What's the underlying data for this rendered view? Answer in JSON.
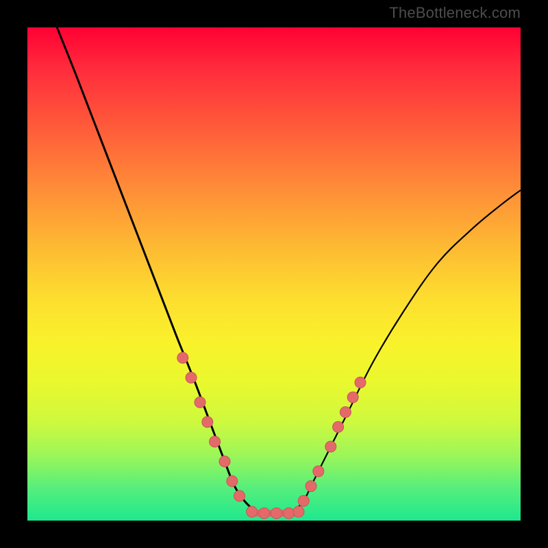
{
  "watermark": "TheBottleneck.com",
  "chart_data": {
    "type": "line",
    "title": "",
    "xlabel": "",
    "ylabel": "",
    "xlim": [
      0,
      100
    ],
    "ylim": [
      0,
      100
    ],
    "grid": false,
    "legend": false,
    "series": [
      {
        "name": "left-curve",
        "x": [
          6,
          10,
          15,
          20,
          25,
          30,
          34,
          37,
          40,
          42,
          44,
          46
        ],
        "values": [
          100,
          90,
          77,
          64,
          51,
          38,
          28,
          20,
          12,
          7,
          4,
          2
        ]
      },
      {
        "name": "right-curve",
        "x": [
          54,
          56,
          58,
          61,
          65,
          70,
          76,
          83,
          90,
          96,
          100
        ],
        "values": [
          2,
          4,
          8,
          14,
          22,
          32,
          42,
          52,
          59,
          64,
          67
        ]
      },
      {
        "name": "plateau",
        "x": [
          46,
          54
        ],
        "values": [
          1.5,
          1.5
        ]
      }
    ],
    "markers": [
      {
        "series": "left-curve",
        "x": 31.5,
        "y": 33
      },
      {
        "series": "left-curve",
        "x": 33.2,
        "y": 29
      },
      {
        "series": "left-curve",
        "x": 35.0,
        "y": 24
      },
      {
        "series": "left-curve",
        "x": 36.5,
        "y": 20
      },
      {
        "series": "left-curve",
        "x": 38.0,
        "y": 16
      },
      {
        "series": "left-curve",
        "x": 40.0,
        "y": 12
      },
      {
        "series": "left-curve",
        "x": 41.5,
        "y": 8
      },
      {
        "series": "left-curve",
        "x": 43.0,
        "y": 5
      },
      {
        "series": "right-curve",
        "x": 56.0,
        "y": 4
      },
      {
        "series": "right-curve",
        "x": 57.5,
        "y": 7
      },
      {
        "series": "right-curve",
        "x": 59.0,
        "y": 10
      },
      {
        "series": "right-curve",
        "x": 61.5,
        "y": 15
      },
      {
        "series": "right-curve",
        "x": 63.0,
        "y": 19
      },
      {
        "series": "right-curve",
        "x": 64.5,
        "y": 22
      },
      {
        "series": "right-curve",
        "x": 66.0,
        "y": 25
      },
      {
        "series": "right-curve",
        "x": 67.5,
        "y": 28
      },
      {
        "series": "plateau",
        "x": 45.5,
        "y": 1.8
      },
      {
        "series": "plateau",
        "x": 48.0,
        "y": 1.5
      },
      {
        "series": "plateau",
        "x": 50.5,
        "y": 1.5
      },
      {
        "series": "plateau",
        "x": 53.0,
        "y": 1.5
      },
      {
        "series": "plateau",
        "x": 55.0,
        "y": 1.8
      }
    ],
    "colors": {
      "curve": "#000000",
      "marker_fill": "#e46a6a",
      "marker_stroke": "#c85555"
    }
  }
}
